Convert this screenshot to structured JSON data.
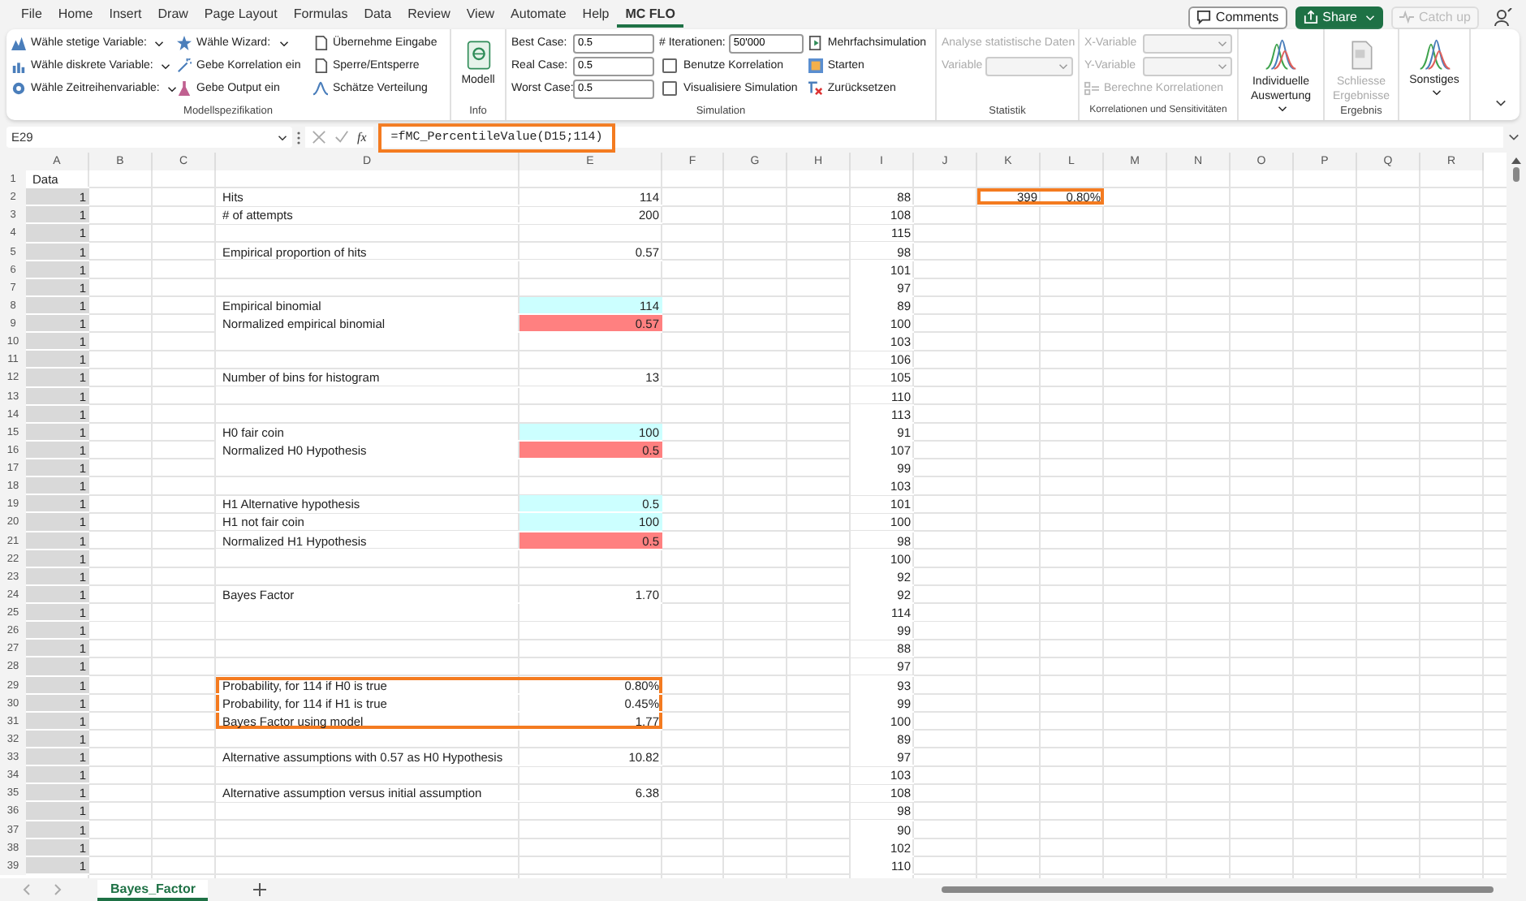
{
  "menu_tabs": [
    {
      "label": "File",
      "selected": false
    },
    {
      "label": "Home",
      "selected": false
    },
    {
      "label": "Insert",
      "selected": false
    },
    {
      "label": "Draw",
      "selected": false
    },
    {
      "label": "Page Layout",
      "selected": false
    },
    {
      "label": "Formulas",
      "selected": false
    },
    {
      "label": "Data",
      "selected": false
    },
    {
      "label": "Review",
      "selected": false
    },
    {
      "label": "View",
      "selected": false
    },
    {
      "label": "Automate",
      "selected": false
    },
    {
      "label": "Help",
      "selected": false
    },
    {
      "label": "MC FLO",
      "selected": true
    }
  ],
  "header_buttons": [
    {
      "kind": "comments",
      "label": "Comments",
      "disabled": false
    },
    {
      "kind": "share",
      "label": "Share",
      "disabled": false
    },
    {
      "kind": "catchup",
      "label": "Catch up",
      "disabled": true
    }
  ],
  "ribbon": {
    "model_spec": {
      "label": "Modellspezifikation",
      "items": [
        {
          "label": "Wähle stetige Variable:",
          "dropdown": true
        },
        {
          "label": "Wähle diskrete Variable:",
          "dropdown": true
        },
        {
          "label": "Wähle Zeitreihenvariable:",
          "dropdown": true
        },
        {
          "label": "Wähle Wizard:",
          "dropdown": true
        },
        {
          "label": "Gebe Korrelation ein",
          "dropdown": false
        },
        {
          "label": "Gebe Output ein",
          "dropdown": false
        },
        {
          "label": "Übernehme Eingabe",
          "dropdown": false
        },
        {
          "label": "Sperre/Entsperre",
          "dropdown": false
        },
        {
          "label": "Schätze Verteilung",
          "dropdown": false
        }
      ]
    },
    "info": {
      "label": "Info",
      "button": "Modell"
    },
    "simulation": {
      "label": "Simulation",
      "fields": [
        {
          "label": "Best Case:",
          "value": "0.5"
        },
        {
          "label": "Real Case:",
          "value": "0.5"
        },
        {
          "label": "Worst Case:",
          "value": "0.5"
        }
      ],
      "iterations": {
        "label": "# Iterationen:",
        "value": "50'000"
      },
      "checks": [
        {
          "label": "Benutze Korrelation",
          "checked": false
        },
        {
          "label": "Visualisiere Simulation",
          "checked": false
        }
      ],
      "actions": [
        "Mehrfachsimulation",
        "Starten",
        "Zurücksetzen"
      ]
    },
    "statistik": {
      "label": "Statistik",
      "button": "Analyse statistische Daten",
      "field_label": "Variable",
      "disabled": true
    },
    "korrelationen": {
      "label": "Korrelationen und Sensitivitäten",
      "dropdowns": [
        "X-Variable",
        "Y-Variable"
      ],
      "button": "Berechne Korrelationen",
      "disabled": true
    },
    "auswertung": {
      "button": "Individuelle Auswertung"
    },
    "ergebnis": {
      "label": "Ergebnis",
      "button": "Schliesse Ergebnisse",
      "disabled": true
    },
    "sonstiges": {
      "button": "Sonstiges"
    }
  },
  "formula_bar": {
    "name_box": "E29",
    "function_label": "fx",
    "formula": "=fMC_PercentileValue(D15;114)",
    "highlighted": true
  },
  "sheet": {
    "columns": [
      "A",
      "B",
      "C",
      "D",
      "E",
      "F",
      "G",
      "H",
      "I",
      "J",
      "K",
      "L",
      "M",
      "N",
      "O",
      "P",
      "Q",
      "R"
    ],
    "rows": [
      {
        "number": "1",
        "cells": [
          {
            "text": "Data",
            "framed": false
          }
        ]
      },
      {
        "number": "2",
        "cells": [
          {
            "text": "1",
            "color": "#d9d9d9",
            "framed": false
          },
          {
            "text": ""
          },
          {
            "text": ""
          },
          {
            "text": "Hits",
            "framed": false
          },
          {
            "text": "114",
            "framed": false
          },
          {
            "text": ""
          },
          {
            "text": ""
          },
          {
            "text": ""
          },
          {
            "text": "88",
            "framed": false
          },
          {
            "text": ""
          },
          {
            "text": "399",
            "framed": true
          },
          {
            "text": "0.80%",
            "framed": true
          }
        ]
      },
      {
        "number": "3",
        "cells": [
          {
            "text": "1",
            "color": "#d9d9d9",
            "framed": false
          },
          {
            "text": ""
          },
          {
            "text": ""
          },
          {
            "text": "# of attempts",
            "framed": false
          },
          {
            "text": "200",
            "framed": false
          },
          {
            "text": ""
          },
          {
            "text": ""
          },
          {
            "text": ""
          },
          {
            "text": "108",
            "framed": false
          }
        ]
      },
      {
        "number": "4",
        "cells": [
          {
            "text": "1",
            "color": "#d9d9d9",
            "framed": false
          },
          {
            "text": ""
          },
          {
            "text": ""
          },
          {
            "text": ""
          },
          {
            "text": ""
          },
          {
            "text": ""
          },
          {
            "text": ""
          },
          {
            "text": ""
          },
          {
            "text": "115",
            "framed": false
          }
        ]
      },
      {
        "number": "5",
        "cells": [
          {
            "text": "1",
            "color": "#d9d9d9",
            "framed": false
          },
          {
            "text": ""
          },
          {
            "text": ""
          },
          {
            "text": "Empirical proportion of hits",
            "framed": false
          },
          {
            "text": "0.57",
            "framed": false
          },
          {
            "text": ""
          },
          {
            "text": ""
          },
          {
            "text": ""
          },
          {
            "text": "98",
            "framed": false
          }
        ]
      },
      {
        "number": "6",
        "cells": [
          {
            "text": "1",
            "color": "#d9d9d9",
            "framed": false
          },
          {
            "text": ""
          },
          {
            "text": ""
          },
          {
            "text": ""
          },
          {
            "text": ""
          },
          {
            "text": ""
          },
          {
            "text": ""
          },
          {
            "text": ""
          },
          {
            "text": "101",
            "framed": false
          }
        ]
      },
      {
        "number": "7",
        "cells": [
          {
            "text": "1",
            "color": "#d9d9d9",
            "framed": false
          },
          {
            "text": ""
          },
          {
            "text": ""
          },
          {
            "text": ""
          },
          {
            "text": ""
          },
          {
            "text": ""
          },
          {
            "text": ""
          },
          {
            "text": ""
          },
          {
            "text": "97",
            "framed": false
          }
        ]
      },
      {
        "number": "8",
        "cells": [
          {
            "text": "1",
            "color": "#d9d9d9",
            "framed": false
          },
          {
            "text": ""
          },
          {
            "text": ""
          },
          {
            "text": "Empirical binomial",
            "framed": false
          },
          {
            "text": "114",
            "color": "#ccffff",
            "framed": false
          },
          {
            "text": ""
          },
          {
            "text": ""
          },
          {
            "text": ""
          },
          {
            "text": "89",
            "framed": false
          }
        ]
      },
      {
        "number": "9",
        "cells": [
          {
            "text": "1",
            "color": "#d9d9d9",
            "framed": false
          },
          {
            "text": ""
          },
          {
            "text": ""
          },
          {
            "text": "Normalized empirical binomial",
            "framed": false
          },
          {
            "text": "0.57",
            "color": "#ff8080",
            "framed": false
          },
          {
            "text": ""
          },
          {
            "text": ""
          },
          {
            "text": ""
          },
          {
            "text": "100",
            "framed": false
          }
        ]
      },
      {
        "number": "10",
        "cells": [
          {
            "text": "1",
            "color": "#d9d9d9",
            "framed": false
          },
          {
            "text": ""
          },
          {
            "text": ""
          },
          {
            "text": ""
          },
          {
            "text": ""
          },
          {
            "text": ""
          },
          {
            "text": ""
          },
          {
            "text": ""
          },
          {
            "text": "103",
            "framed": false
          }
        ]
      },
      {
        "number": "11",
        "cells": [
          {
            "text": "1",
            "color": "#d9d9d9",
            "framed": false
          },
          {
            "text": ""
          },
          {
            "text": ""
          },
          {
            "text": ""
          },
          {
            "text": ""
          },
          {
            "text": ""
          },
          {
            "text": ""
          },
          {
            "text": ""
          },
          {
            "text": "106",
            "framed": false
          }
        ]
      },
      {
        "number": "12",
        "cells": [
          {
            "text": "1",
            "color": "#d9d9d9",
            "framed": false
          },
          {
            "text": ""
          },
          {
            "text": ""
          },
          {
            "text": "Number of bins for histogram",
            "framed": false
          },
          {
            "text": "13",
            "framed": false
          },
          {
            "text": ""
          },
          {
            "text": ""
          },
          {
            "text": ""
          },
          {
            "text": "105",
            "framed": false
          }
        ]
      },
      {
        "number": "13",
        "cells": [
          {
            "text": "1",
            "color": "#d9d9d9",
            "framed": false
          },
          {
            "text": ""
          },
          {
            "text": ""
          },
          {
            "text": ""
          },
          {
            "text": ""
          },
          {
            "text": ""
          },
          {
            "text": ""
          },
          {
            "text": ""
          },
          {
            "text": "110",
            "framed": false
          }
        ]
      },
      {
        "number": "14",
        "cells": [
          {
            "text": "1",
            "color": "#d9d9d9",
            "framed": false
          },
          {
            "text": ""
          },
          {
            "text": ""
          },
          {
            "text": ""
          },
          {
            "text": ""
          },
          {
            "text": ""
          },
          {
            "text": ""
          },
          {
            "text": ""
          },
          {
            "text": "113",
            "framed": false
          }
        ]
      },
      {
        "number": "15",
        "cells": [
          {
            "text": "1",
            "color": "#d9d9d9",
            "framed": false
          },
          {
            "text": ""
          },
          {
            "text": ""
          },
          {
            "text": "H0 fair coin",
            "framed": false
          },
          {
            "text": "100",
            "color": "#ccffff",
            "framed": false
          },
          {
            "text": ""
          },
          {
            "text": ""
          },
          {
            "text": ""
          },
          {
            "text": "91",
            "framed": false
          }
        ]
      },
      {
        "number": "16",
        "cells": [
          {
            "text": "1",
            "color": "#d9d9d9",
            "framed": false
          },
          {
            "text": ""
          },
          {
            "text": ""
          },
          {
            "text": "Normalized H0 Hypothesis",
            "framed": false
          },
          {
            "text": "0.5",
            "color": "#ff8080",
            "framed": false
          },
          {
            "text": ""
          },
          {
            "text": ""
          },
          {
            "text": ""
          },
          {
            "text": "107",
            "framed": false
          }
        ]
      },
      {
        "number": "17",
        "cells": [
          {
            "text": "1",
            "color": "#d9d9d9",
            "framed": false
          },
          {
            "text": ""
          },
          {
            "text": ""
          },
          {
            "text": ""
          },
          {
            "text": ""
          },
          {
            "text": ""
          },
          {
            "text": ""
          },
          {
            "text": ""
          },
          {
            "text": "99",
            "framed": false
          }
        ]
      },
      {
        "number": "18",
        "cells": [
          {
            "text": "1",
            "color": "#d9d9d9",
            "framed": false
          },
          {
            "text": ""
          },
          {
            "text": ""
          },
          {
            "text": ""
          },
          {
            "text": ""
          },
          {
            "text": ""
          },
          {
            "text": ""
          },
          {
            "text": ""
          },
          {
            "text": "103",
            "framed": false
          }
        ]
      },
      {
        "number": "19",
        "cells": [
          {
            "text": "1",
            "color": "#d9d9d9",
            "framed": false
          },
          {
            "text": ""
          },
          {
            "text": ""
          },
          {
            "text": "H1 Alternative hypothesis",
            "framed": false
          },
          {
            "text": "0.5",
            "color": "#ccffff",
            "framed": false
          },
          {
            "text": ""
          },
          {
            "text": ""
          },
          {
            "text": ""
          },
          {
            "text": "101",
            "framed": false
          }
        ]
      },
      {
        "number": "20",
        "cells": [
          {
            "text": "1",
            "color": "#d9d9d9",
            "framed": false
          },
          {
            "text": ""
          },
          {
            "text": ""
          },
          {
            "text": "H1 not fair coin",
            "framed": false
          },
          {
            "text": "100",
            "color": "#ccffff",
            "framed": false
          },
          {
            "text": ""
          },
          {
            "text": ""
          },
          {
            "text": ""
          },
          {
            "text": "100",
            "framed": false
          }
        ]
      },
      {
        "number": "21",
        "cells": [
          {
            "text": "1",
            "color": "#d9d9d9",
            "framed": false
          },
          {
            "text": ""
          },
          {
            "text": ""
          },
          {
            "text": "Normalized H1 Hypothesis",
            "framed": false
          },
          {
            "text": "0.5",
            "color": "#ff8080",
            "framed": false
          },
          {
            "text": ""
          },
          {
            "text": ""
          },
          {
            "text": ""
          },
          {
            "text": "98",
            "framed": false
          }
        ]
      },
      {
        "number": "22",
        "cells": [
          {
            "text": "1",
            "color": "#d9d9d9",
            "framed": false
          },
          {
            "text": ""
          },
          {
            "text": ""
          },
          {
            "text": ""
          },
          {
            "text": ""
          },
          {
            "text": ""
          },
          {
            "text": ""
          },
          {
            "text": ""
          },
          {
            "text": "100",
            "framed": false
          }
        ]
      },
      {
        "number": "23",
        "cells": [
          {
            "text": "1",
            "color": "#d9d9d9",
            "framed": false
          },
          {
            "text": ""
          },
          {
            "text": ""
          },
          {
            "text": ""
          },
          {
            "text": ""
          },
          {
            "text": ""
          },
          {
            "text": ""
          },
          {
            "text": ""
          },
          {
            "text": "92",
            "framed": false
          }
        ]
      },
      {
        "number": "24",
        "cells": [
          {
            "text": "1",
            "color": "#d9d9d9",
            "framed": false
          },
          {
            "text": ""
          },
          {
            "text": ""
          },
          {
            "text": "Bayes Factor",
            "framed": false
          },
          {
            "text": "1.70",
            "framed": false
          },
          {
            "text": ""
          },
          {
            "text": ""
          },
          {
            "text": ""
          },
          {
            "text": "92",
            "framed": false
          }
        ]
      },
      {
        "number": "25",
        "cells": [
          {
            "text": "1",
            "color": "#d9d9d9",
            "framed": false
          },
          {
            "text": ""
          },
          {
            "text": ""
          },
          {
            "text": ""
          },
          {
            "text": ""
          },
          {
            "text": ""
          },
          {
            "text": ""
          },
          {
            "text": ""
          },
          {
            "text": "114",
            "framed": false
          }
        ]
      },
      {
        "number": "26",
        "cells": [
          {
            "text": "1",
            "color": "#d9d9d9",
            "framed": false
          },
          {
            "text": ""
          },
          {
            "text": ""
          },
          {
            "text": ""
          },
          {
            "text": ""
          },
          {
            "text": ""
          },
          {
            "text": ""
          },
          {
            "text": ""
          },
          {
            "text": "99",
            "framed": false
          }
        ]
      },
      {
        "number": "27",
        "cells": [
          {
            "text": "1",
            "color": "#d9d9d9",
            "framed": false
          },
          {
            "text": ""
          },
          {
            "text": ""
          },
          {
            "text": ""
          },
          {
            "text": ""
          },
          {
            "text": ""
          },
          {
            "text": ""
          },
          {
            "text": ""
          },
          {
            "text": "88",
            "framed": false
          }
        ]
      },
      {
        "number": "28",
        "cells": [
          {
            "text": "1",
            "color": "#d9d9d9",
            "framed": false
          },
          {
            "text": ""
          },
          {
            "text": ""
          },
          {
            "text": ""
          },
          {
            "text": ""
          },
          {
            "text": ""
          },
          {
            "text": ""
          },
          {
            "text": ""
          },
          {
            "text": "97",
            "framed": false
          }
        ]
      },
      {
        "number": "29",
        "cells": [
          {
            "text": "1",
            "color": "#d9d9d9",
            "framed": false
          },
          {
            "text": ""
          },
          {
            "text": ""
          },
          {
            "text": "Probability, for 114 if H0 is true",
            "framed": true
          },
          {
            "text": "0.80%",
            "framed": true
          },
          {
            "text": ""
          },
          {
            "text": ""
          },
          {
            "text": ""
          },
          {
            "text": "93",
            "framed": false
          }
        ]
      },
      {
        "number": "30",
        "cells": [
          {
            "text": "1",
            "color": "#d9d9d9",
            "framed": false
          },
          {
            "text": ""
          },
          {
            "text": ""
          },
          {
            "text": "Probability, for 114 if H1 is true",
            "framed": true
          },
          {
            "text": "0.45%",
            "framed": true
          },
          {
            "text": ""
          },
          {
            "text": ""
          },
          {
            "text": ""
          },
          {
            "text": "99",
            "framed": false
          }
        ]
      },
      {
        "number": "31",
        "cells": [
          {
            "text": "1",
            "color": "#d9d9d9",
            "framed": false
          },
          {
            "text": ""
          },
          {
            "text": ""
          },
          {
            "text": "Bayes Factor using model",
            "framed": true
          },
          {
            "text": "1.77",
            "framed": true
          },
          {
            "text": ""
          },
          {
            "text": ""
          },
          {
            "text": ""
          },
          {
            "text": "100",
            "framed": false
          }
        ]
      },
      {
        "number": "32",
        "cells": [
          {
            "text": "1",
            "color": "#d9d9d9",
            "framed": false
          },
          {
            "text": ""
          },
          {
            "text": ""
          },
          {
            "text": ""
          },
          {
            "text": ""
          },
          {
            "text": ""
          },
          {
            "text": ""
          },
          {
            "text": ""
          },
          {
            "text": "89",
            "framed": false
          }
        ]
      },
      {
        "number": "33",
        "cells": [
          {
            "text": "1",
            "color": "#d9d9d9",
            "framed": false
          },
          {
            "text": ""
          },
          {
            "text": ""
          },
          {
            "text": "Alternative assumptions with 0.57 as H0 Hypothesis",
            "framed": false
          },
          {
            "text": "10.82",
            "framed": false
          },
          {
            "text": ""
          },
          {
            "text": ""
          },
          {
            "text": ""
          },
          {
            "text": "97",
            "framed": false
          }
        ]
      },
      {
        "number": "34",
        "cells": [
          {
            "text": "1",
            "color": "#d9d9d9",
            "framed": false
          },
          {
            "text": ""
          },
          {
            "text": ""
          },
          {
            "text": ""
          },
          {
            "text": ""
          },
          {
            "text": ""
          },
          {
            "text": ""
          },
          {
            "text": ""
          },
          {
            "text": "103",
            "framed": false
          }
        ]
      },
      {
        "number": "35",
        "cells": [
          {
            "text": "1",
            "color": "#d9d9d9",
            "framed": false
          },
          {
            "text": ""
          },
          {
            "text": ""
          },
          {
            "text": "Alternative assumption versus initial assumption",
            "framed": false
          },
          {
            "text": "6.38",
            "framed": false
          },
          {
            "text": ""
          },
          {
            "text": ""
          },
          {
            "text": ""
          },
          {
            "text": "108",
            "framed": false
          }
        ]
      },
      {
        "number": "36",
        "cells": [
          {
            "text": "1",
            "color": "#d9d9d9",
            "framed": false
          },
          {
            "text": ""
          },
          {
            "text": ""
          },
          {
            "text": ""
          },
          {
            "text": ""
          },
          {
            "text": ""
          },
          {
            "text": ""
          },
          {
            "text": ""
          },
          {
            "text": "98",
            "framed": false
          }
        ]
      },
      {
        "number": "37",
        "cells": [
          {
            "text": "1",
            "color": "#d9d9d9",
            "framed": false
          },
          {
            "text": ""
          },
          {
            "text": ""
          },
          {
            "text": ""
          },
          {
            "text": ""
          },
          {
            "text": ""
          },
          {
            "text": ""
          },
          {
            "text": ""
          },
          {
            "text": "90",
            "framed": false
          }
        ]
      },
      {
        "number": "38",
        "cells": [
          {
            "text": "1",
            "color": "#d9d9d9",
            "framed": false
          },
          {
            "text": ""
          },
          {
            "text": ""
          },
          {
            "text": ""
          },
          {
            "text": ""
          },
          {
            "text": ""
          },
          {
            "text": ""
          },
          {
            "text": ""
          },
          {
            "text": "102",
            "framed": false
          }
        ]
      },
      {
        "number": "39",
        "cells": [
          {
            "text": "1",
            "color": "#d9d9d9",
            "framed": false
          },
          {
            "text": ""
          },
          {
            "text": ""
          },
          {
            "text": ""
          },
          {
            "text": ""
          },
          {
            "text": ""
          },
          {
            "text": ""
          },
          {
            "text": ""
          },
          {
            "text": "110",
            "framed": false
          }
        ]
      }
    ]
  },
  "sheet_tabs": [
    {
      "label": "Bayes_Factor",
      "selected": true
    }
  ]
}
